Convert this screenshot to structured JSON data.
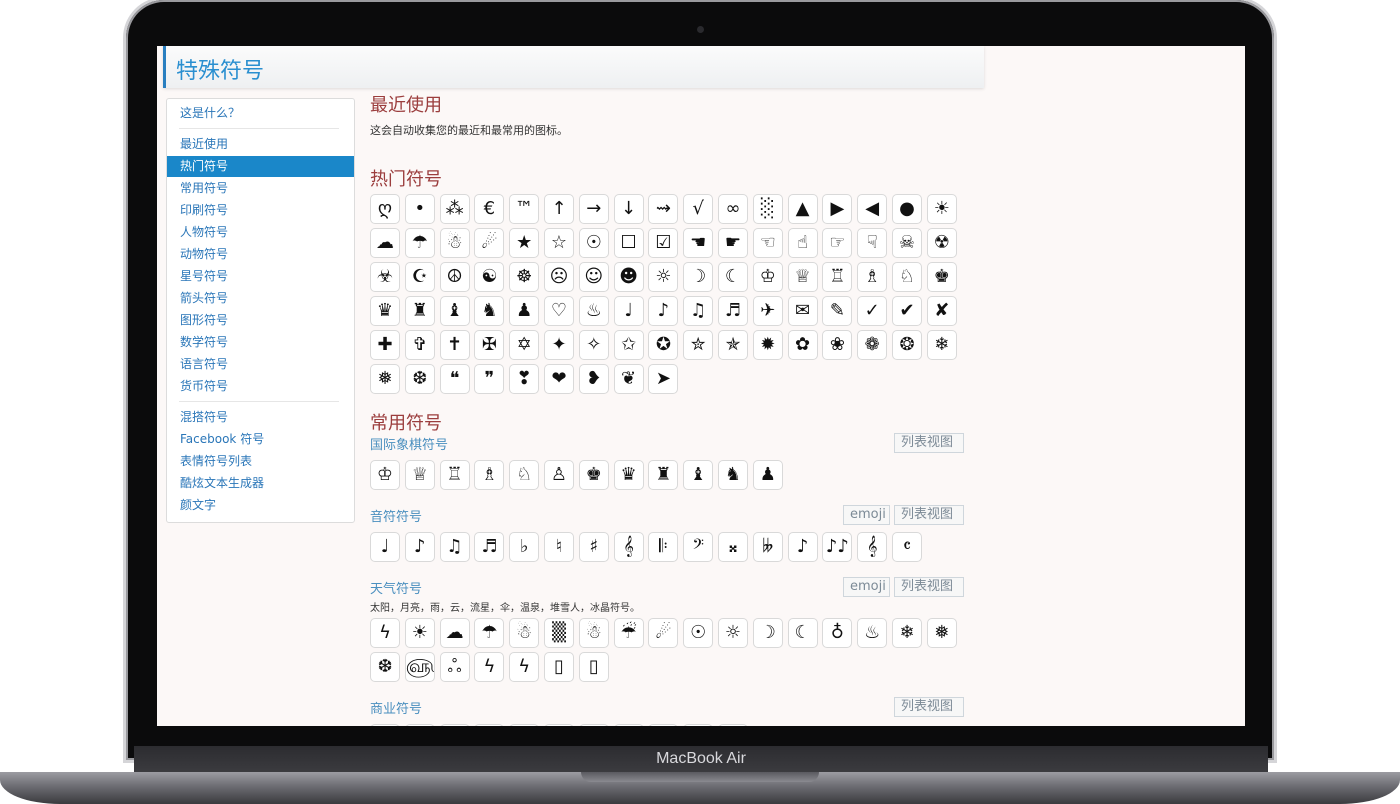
{
  "site": {
    "title": "特殊符号"
  },
  "device": {
    "label": "MacBook Air"
  },
  "sidebar": {
    "top": [
      {
        "label": "这是什么？"
      }
    ],
    "categories": [
      {
        "label": "最近使用"
      },
      {
        "label": "热门符号",
        "active": true
      },
      {
        "label": "常用符号"
      },
      {
        "label": "印刷符号"
      },
      {
        "label": "人物符号"
      },
      {
        "label": "动物符号"
      },
      {
        "label": "星号符号"
      },
      {
        "label": "箭头符号"
      },
      {
        "label": "图形符号"
      },
      {
        "label": "数学符号"
      },
      {
        "label": "语言符号"
      },
      {
        "label": "货币符号"
      }
    ],
    "extras": [
      {
        "label": "混搭符号"
      },
      {
        "label": "Facebook 符号"
      },
      {
        "label": "表情符号列表"
      },
      {
        "label": "酷炫文本生成器"
      },
      {
        "label": "颜文字"
      }
    ]
  },
  "recent": {
    "title": "最近使用",
    "desc": "这会自动收集您的最近和最常用的图标。"
  },
  "popular": {
    "title": "热门符号",
    "symbols": [
      "ღ",
      "•",
      "⁂",
      "€",
      "™",
      "↑",
      "→",
      "↓",
      "⇝",
      "√",
      "∞",
      "░",
      "▲",
      "▶",
      "◀",
      "●",
      "☀",
      "☁",
      "☂",
      "☃",
      "☄",
      "★",
      "☆",
      "☉",
      "☐",
      "☑",
      "☚",
      "☛",
      "☜",
      "☝",
      "☞",
      "☟",
      "☠",
      "☢",
      "☣",
      "☪",
      "☮",
      "☯",
      "☸",
      "☹",
      "☺",
      "☻",
      "☼",
      "☽",
      "☾",
      "♔",
      "♕",
      "♖",
      "♗",
      "♘",
      "♚",
      "♛",
      "♜",
      "♝",
      "♞",
      "♟",
      "♡",
      "♨",
      "♩",
      "♪",
      "♫",
      "♬",
      "✈",
      "✉",
      "✎",
      "✓",
      "✔",
      "✘",
      "✚",
      "✞",
      "✝",
      "✠",
      "✡",
      "✦",
      "✧",
      "✩",
      "✪",
      "✮",
      "✯",
      "✹",
      "✿",
      "❀",
      "❁",
      "❂",
      "❄",
      "❅",
      "❆",
      "❝",
      "❞",
      "❣",
      "❤",
      "❥",
      "❦",
      "➤"
    ]
  },
  "common": {
    "title": "常用符号"
  },
  "groups": [
    {
      "title": "国际象棋符号",
      "buttons": [
        "列表视图"
      ],
      "desc": "",
      "symbols": [
        "♔",
        "♕",
        "♖",
        "♗",
        "♘",
        "♙",
        "♚",
        "♛",
        "♜",
        "♝",
        "♞",
        "♟"
      ]
    },
    {
      "title": "音符符号",
      "buttons": [
        "emoji",
        "列表视图"
      ],
      "desc": "",
      "symbols": [
        "♩",
        "♪",
        "♫",
        "♬",
        "♭",
        "♮",
        "♯",
        "𝄞",
        "𝄆",
        "𝄢",
        "𝄪",
        "𝄫",
        "♪",
        "♪♪",
        "𝄞",
        "𝄴"
      ]
    },
    {
      "title": "天气符号",
      "buttons": [
        "emoji",
        "列表视图"
      ],
      "desc": "太阳，月亮，雨，云，流星，伞，温泉，堆雪人，冰晶符号。",
      "symbols": [
        "ϟ",
        "☀",
        "☁",
        "☂",
        "☃",
        "▒",
        "☃",
        "☔",
        "☄",
        "☉",
        "☼",
        "☽",
        "☾",
        "♁",
        "♨",
        "❄",
        "❅",
        "❆",
        "௵",
        "ஃ",
        "ϟ",
        "ϟ",
        "▯",
        "▯"
      ]
    },
    {
      "title": "商业符号",
      "buttons": [
        "列表视图"
      ],
      "desc": "",
      "symbols": [
        "©",
        "®",
        "™",
        "℠",
        "℗",
        "№",
        "℡",
        "☎",
        "✆",
        "✉",
        "✍"
      ]
    }
  ]
}
